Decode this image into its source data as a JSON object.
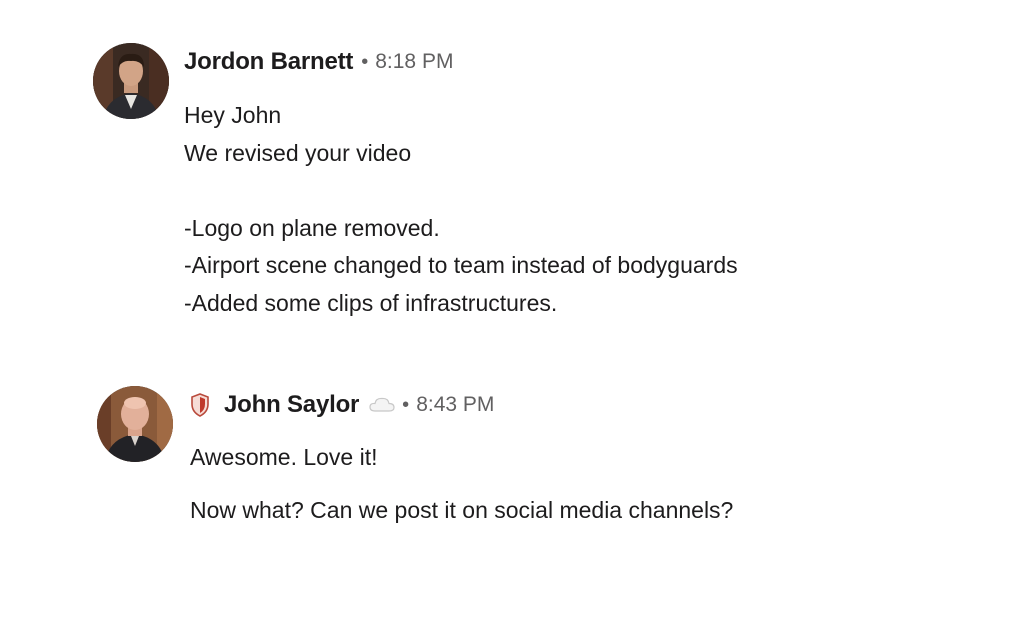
{
  "messages": [
    {
      "author": "Jordon Barnett",
      "separator": "•",
      "time": "8:18 PM",
      "avatar_icon": "person-avatar-dark-suit",
      "lines": [
        "Hey John",
        "We revised your video",
        "",
        "-Logo on plane removed.",
        "-Airport scene changed to team instead of bodyguards",
        "-Added some clips of infrastructures."
      ]
    },
    {
      "author": "John Saylor",
      "separator": "•",
      "time": "8:43 PM",
      "avatar_icon": "person-avatar-bald",
      "badge_icon": "shield-icon",
      "status_icon": "cloud-icon",
      "lines": [
        "Awesome. Love it!",
        "Now what? Can we post it on social media channels?"
      ]
    }
  ],
  "colors": {
    "text": "#1d1c1d",
    "meta": "#616061",
    "shield_red": "#c0392b"
  }
}
